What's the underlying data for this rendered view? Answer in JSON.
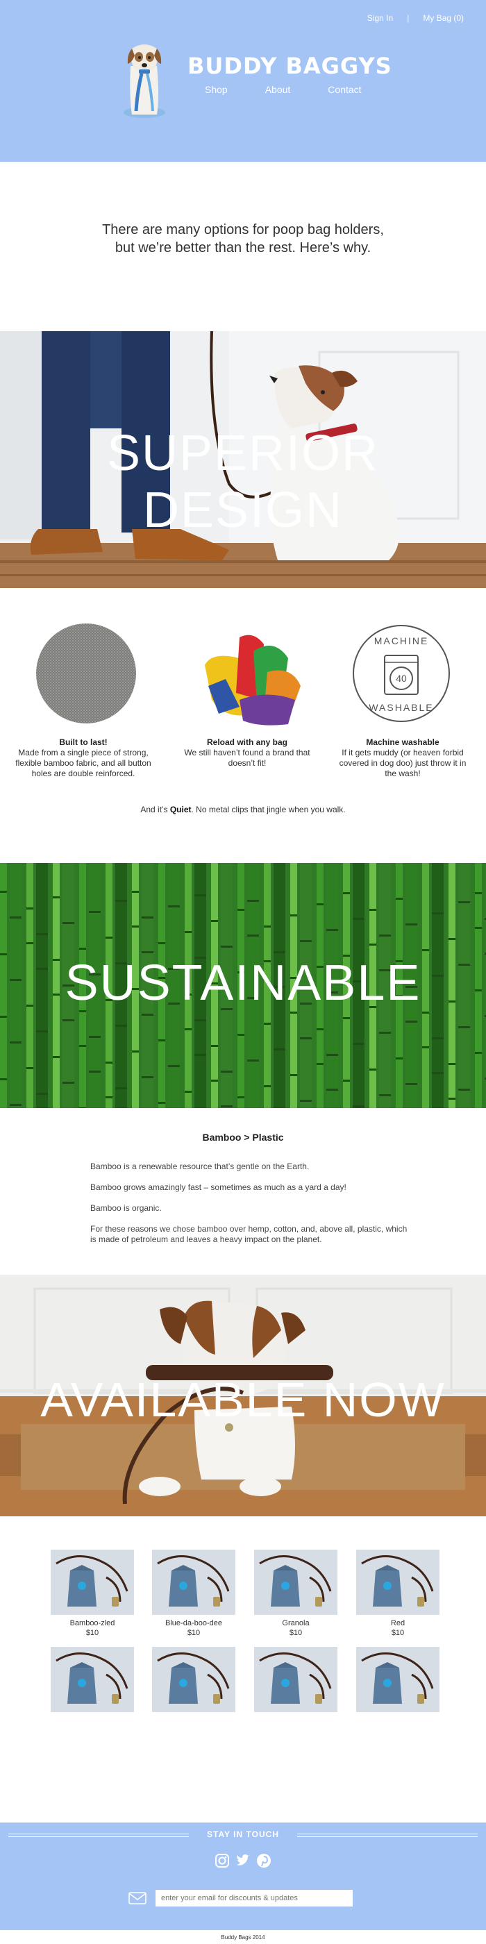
{
  "header": {
    "sign_in": "Sign In",
    "separator": "|",
    "my_bag": "My Bag (0)",
    "brand": "BUDDY BAGGYS",
    "nav": [
      "Shop",
      "About",
      "Contact"
    ]
  },
  "intro": {
    "line1": "There are many options for poop bag holders,",
    "line2": "but we’re better than the rest. Here’s why."
  },
  "sections": {
    "design_title": "SUPERIOR DESIGN",
    "sustainable_title": "SUSTAINABLE",
    "available_title": "AVAILABLE NOW"
  },
  "features": [
    {
      "title": "Built to last!",
      "text": "Made from a single piece of strong, flexible bamboo fabric, and all button holes are double reinforced.",
      "icon": "fabric-swatch-icon"
    },
    {
      "title": "Reload with any bag",
      "text": "We still haven’t found a brand that doesn’t fit!",
      "icon": "colored-bags-icon"
    },
    {
      "title": "Machine washable",
      "text": "If it gets muddy (or heaven forbid covered in dog doo) just throw it in the wash!",
      "icon": "washing-machine-icon",
      "badge_top": "MACHINE",
      "badge_bottom": "WASHABLE",
      "badge_number": "40"
    }
  ],
  "quiet": {
    "prefix": "And it’s ",
    "bold": "Quiet",
    "suffix": ". No metal clips that jingle when you walk."
  },
  "bamboo": {
    "title": "Bamboo > Plastic",
    "paragraphs": [
      "Bamboo is a renewable resource that’s gentle on the Earth.",
      "Bamboo grows amazingly fast – sometimes as much as a yard a day!",
      "Bamboo is organic.",
      "For these reasons we chose bamboo over hemp, cotton, and, above all, plastic, which is made of petroleum and leaves a heavy impact on the planet."
    ]
  },
  "products": [
    {
      "name": "Bamboo-zled",
      "price": "$10"
    },
    {
      "name": "Blue-da-boo-dee",
      "price": "$10"
    },
    {
      "name": "Granola",
      "price": "$10"
    },
    {
      "name": "Red",
      "price": "$10"
    },
    {
      "name": "",
      "price": ""
    },
    {
      "name": "",
      "price": ""
    },
    {
      "name": "",
      "price": ""
    },
    {
      "name": "",
      "price": ""
    }
  ],
  "footer": {
    "stay": "STAY IN TOUCH",
    "email_placeholder": "enter your email for discounts & updates",
    "social_icons": [
      "instagram-icon",
      "twitter-icon",
      "pinterest-icon"
    ],
    "copyright": "Buddy Bags 2014"
  },
  "colors": {
    "accent": "#a4c4f6",
    "text": "#333333",
    "bag_blue": "#4a7fb0",
    "leash_brown": "#4a2a1a"
  }
}
